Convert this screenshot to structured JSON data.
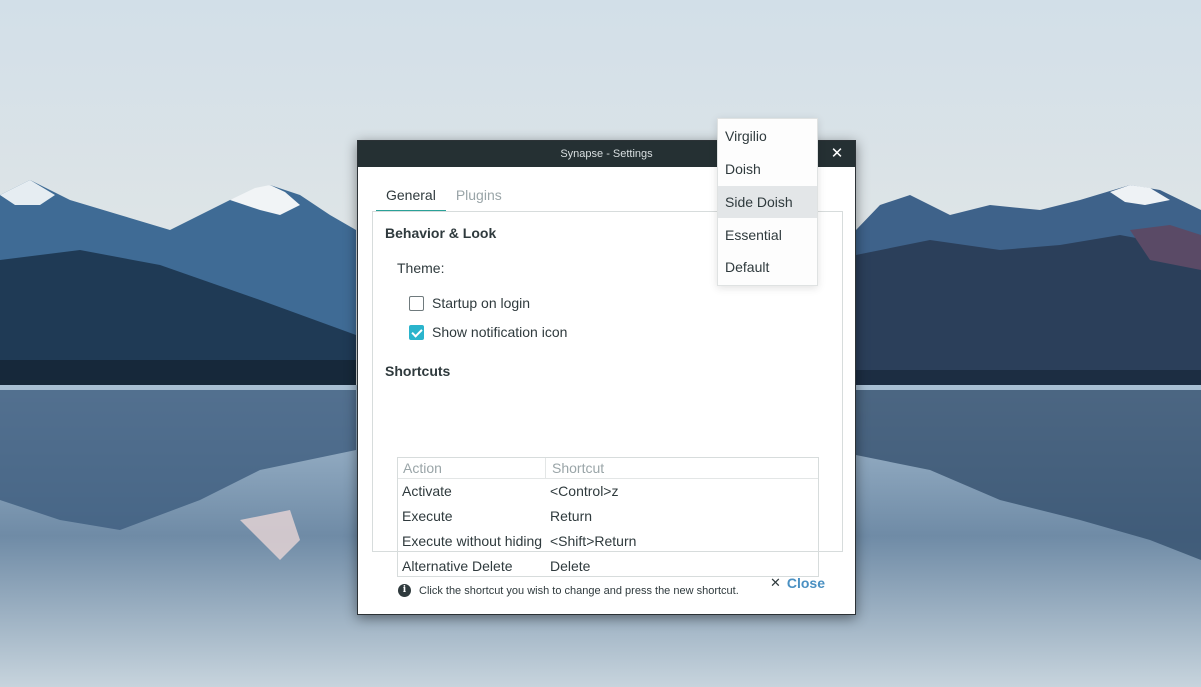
{
  "window": {
    "title": "Synapse - Settings",
    "close_glyph": "✕"
  },
  "tabs": [
    {
      "label": "General",
      "active": true
    },
    {
      "label": "Plugins",
      "active": false
    }
  ],
  "behavior": {
    "section_title": "Behavior & Look",
    "theme_label": "Theme:",
    "startup_label": "Startup on login",
    "startup_checked": false,
    "notification_label": "Show notification icon",
    "notification_checked": true
  },
  "shortcuts": {
    "section_title": "Shortcuts",
    "columns": [
      "Action",
      "Shortcut"
    ],
    "rows": [
      {
        "action": "Activate",
        "shortcut": "<Control>z"
      },
      {
        "action": "Execute",
        "shortcut": "Return"
      },
      {
        "action": "Execute without hiding",
        "shortcut": "<Shift>Return"
      },
      {
        "action": "Alternative Delete",
        "shortcut": "Delete"
      }
    ],
    "hint": "Click the shortcut you wish to change and press the new shortcut."
  },
  "footer": {
    "close_label": "Close",
    "close_glyph": "✕"
  },
  "theme_popup": {
    "options": [
      "Virgilio",
      "Doish",
      "Side Doish",
      "Essential",
      "Default"
    ],
    "highlighted": "Side Doish"
  },
  "colors": {
    "accent": "#2aa198",
    "checkbox": "#2ab4cc",
    "link": "#4a90c2",
    "titlebar": "#253033"
  }
}
